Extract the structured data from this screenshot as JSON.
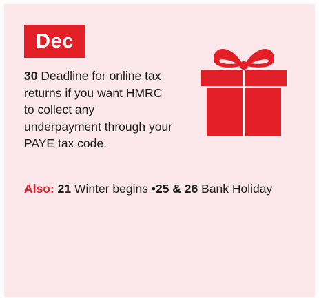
{
  "month": "Dec",
  "main": {
    "date": "30",
    "text": "Deadline for online tax returns if you want HMRC to collect any underpayment through your PAYE tax code."
  },
  "also": {
    "label": "Also:",
    "items": [
      {
        "date": "21",
        "text": "Winter begins"
      },
      {
        "separator": "•",
        "date": "25 & 26",
        "text": "Bank Holiday"
      }
    ]
  },
  "icon": "gift-icon",
  "colors": {
    "accent": "#e21e26",
    "background": "#fce8ea",
    "text": "#1b1b1b"
  }
}
